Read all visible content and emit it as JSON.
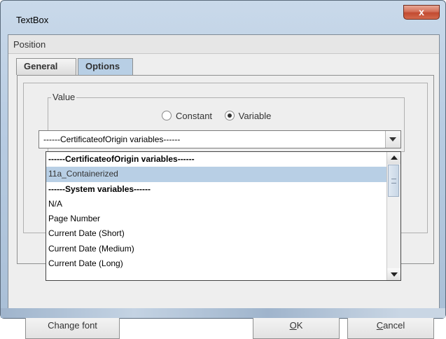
{
  "window": {
    "title": "TextBox",
    "close_glyph": "x"
  },
  "menu": {
    "position": "Position"
  },
  "tabs": {
    "general": "General",
    "options": "Options"
  },
  "value_group": {
    "label": "Value",
    "radio_constant": "Constant",
    "radio_variable": "Variable",
    "selected": "Variable"
  },
  "combo": {
    "value": "------CertificateofOrigin variables------",
    "icon": "chevron-down-icon"
  },
  "dropdown": {
    "items": [
      {
        "label": "------CertificateofOrigin variables------",
        "bold": true
      },
      {
        "label": "11a_Containerized",
        "selected": true
      },
      {
        "label": "------System variables------",
        "bold": true
      },
      {
        "label": "N/A"
      },
      {
        "label": "Page Number"
      },
      {
        "label": "Current Date (Short)"
      },
      {
        "label": "Current Date (Medium)"
      },
      {
        "label": "Current Date (Long)"
      }
    ]
  },
  "buttons": {
    "change_font": "Change font",
    "ok_mnemonic": "O",
    "ok_rest": "K",
    "cancel_mnemonic": "C",
    "cancel_rest": "ancel"
  },
  "colors": {
    "selection": "#b8cfe5",
    "close_button": "#c24a30"
  }
}
